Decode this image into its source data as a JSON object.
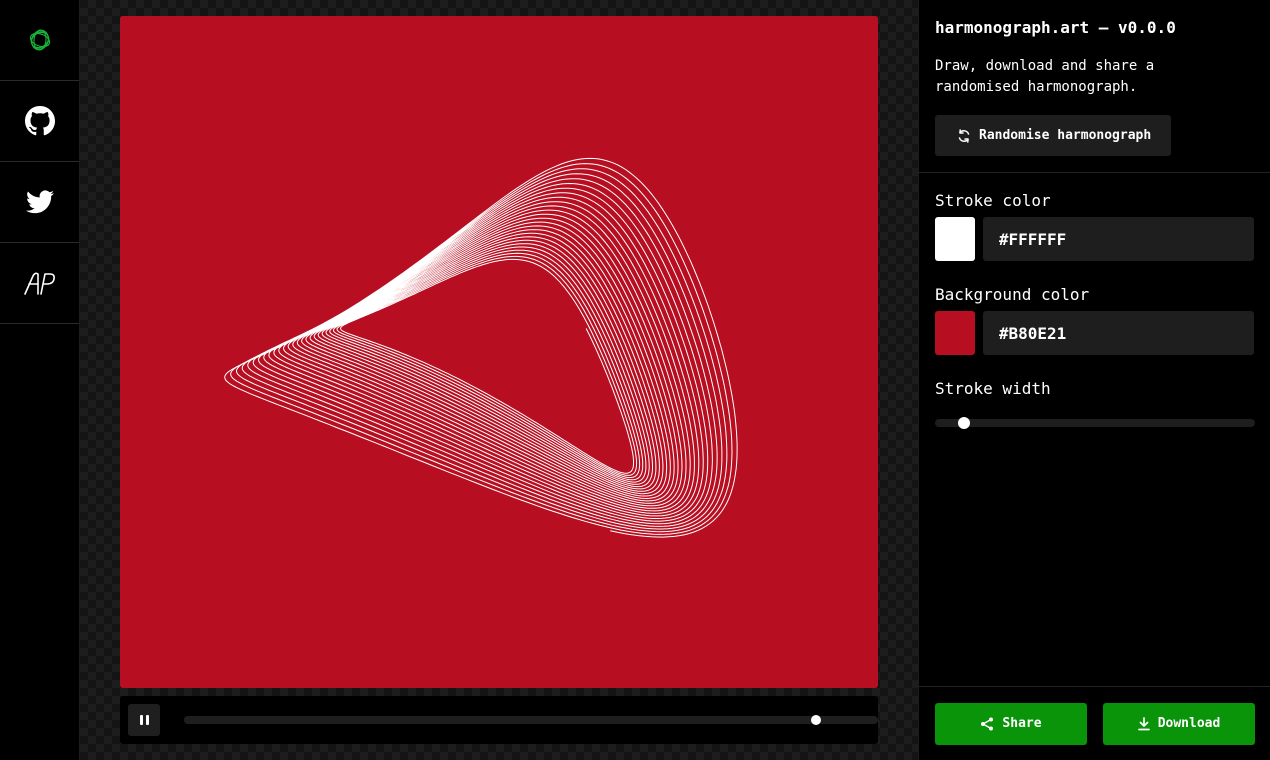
{
  "app": {
    "title": "harmonograph.art — v0.0.0",
    "description": "Draw, download and share a randomised harmonograph."
  },
  "nav": {
    "items": [
      {
        "icon": "logo-icon"
      },
      {
        "icon": "github-icon"
      },
      {
        "icon": "twitter-icon"
      },
      {
        "icon": "ap-logo-icon"
      }
    ]
  },
  "actions": {
    "randomise_label": "Randomise harmonograph",
    "share_label": "Share",
    "download_label": "Download"
  },
  "controls": {
    "stroke_color_label": "Stroke color",
    "stroke_color_value": "#FFFFFF",
    "background_color_label": "Background color",
    "background_color_value": "#B80E21",
    "stroke_width_label": "Stroke width",
    "stroke_width_fraction": 0.09
  },
  "playback": {
    "state": "playing",
    "progress_fraction": 0.91
  },
  "colors": {
    "accent_green": "#09940A",
    "canvas_background": "#B80E21",
    "stroke": "#FFFFFF"
  }
}
